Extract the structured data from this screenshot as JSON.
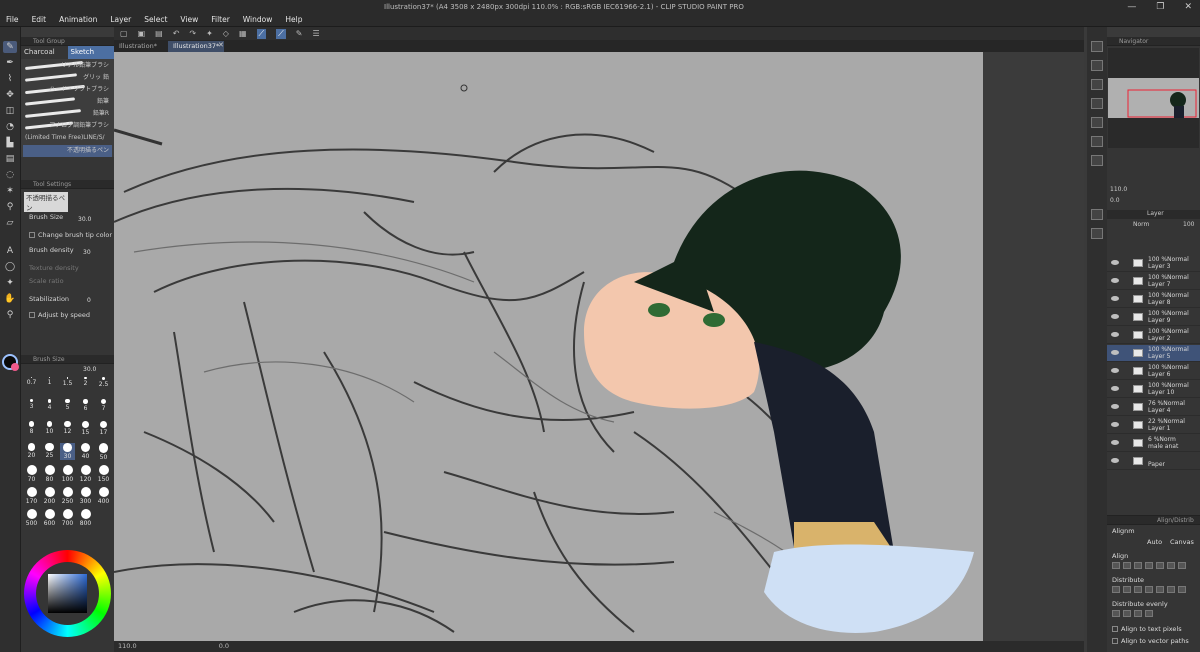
{
  "window": {
    "title": "Illustration37* (A4 3508 x 2480px 300dpi 110.0% : RGB:sRGB IEC61966-2.1) - CLIP STUDIO PAINT PRO",
    "menu": [
      "File",
      "Edit",
      "Animation",
      "Layer",
      "Select",
      "View",
      "Filter",
      "Window",
      "Help"
    ],
    "controls": [
      "—",
      "❐",
      "✕"
    ]
  },
  "doc_tabs": [
    "Illustration*",
    "Illustration37*"
  ],
  "tool_group": {
    "header": "Tool Group",
    "tabs": [
      "Charcoal",
      "Sketch"
    ],
    "active_tab": "Sketch",
    "brushes": [
      "リアル鉛筆ブラシ",
      "グリッ 鉛",
      "ハード・ソフトブラシ",
      "鉛筆",
      "鉛筆R",
      "アナログ調鉛筆ブラシ",
      "(Limited Time Free)LINE/S/",
      "不透明描るペン"
    ]
  },
  "tool_settings": {
    "header": "Tool Settings",
    "brush_name": "不透明描るペン",
    "brush_size_label": "Brush Size",
    "brush_size_value": "30.0",
    "change_tip_color": "Change brush tip color",
    "brush_density_label": "Brush density",
    "brush_density_value": "30",
    "texture_density": "Texture density",
    "scale_ratio": "Scale ratio",
    "stabilization_label": "Stabilization",
    "stabilization_value": "0",
    "adjust_by_speed": "Adjust by speed"
  },
  "brush_size_panel": {
    "header": "Brush Size",
    "current": "30.0",
    "sizes": [
      "0.7",
      "1",
      "1.5",
      "2",
      "2.5",
      "3",
      "4",
      "5",
      "6",
      "7",
      "8",
      "10",
      "12",
      "15",
      "17",
      "20",
      "25",
      "30",
      "40",
      "50",
      "70",
      "80",
      "100",
      "120",
      "150",
      "170",
      "200",
      "250",
      "300",
      "400",
      "500",
      "600",
      "700",
      "800"
    ],
    "selected": "30"
  },
  "status": {
    "zoom": "110.0",
    "rotation": "0.0"
  },
  "navigator": {
    "header": "Navigator",
    "zoom": "110.0",
    "rotation": "0.0"
  },
  "layer_panel": {
    "header": "Layer",
    "blend_mode": "Norm",
    "opacity": "100",
    "layers": [
      {
        "opacity": "100 %Normal",
        "name": "Layer 3",
        "selected": false
      },
      {
        "opacity": "100 %Normal",
        "name": "Layer 7",
        "selected": false
      },
      {
        "opacity": "100 %Normal",
        "name": "Layer 8",
        "selected": false
      },
      {
        "opacity": "100 %Normal",
        "name": "Layer 9",
        "selected": false
      },
      {
        "opacity": "100 %Normal",
        "name": "Layer 2",
        "selected": false
      },
      {
        "opacity": "100 %Normal",
        "name": "Layer 5",
        "selected": true
      },
      {
        "opacity": "100 %Normal",
        "name": "Layer 6",
        "selected": false
      },
      {
        "opacity": "100 %Normal",
        "name": "Layer 10",
        "selected": false
      },
      {
        "opacity": "76 %Normal",
        "name": "Layer 4",
        "selected": false
      },
      {
        "opacity": "22 %Normal",
        "name": "Layer 1",
        "selected": false
      },
      {
        "opacity": "6 %Norm",
        "name": "male anat",
        "selected": false
      },
      {
        "opacity": "",
        "name": "Paper",
        "selected": false
      }
    ]
  },
  "align_panel": {
    "header": "Align/Distrib",
    "align_label": "Alignm",
    "mode": "Auto",
    "target": "Canvas",
    "align": "Align",
    "distribute": "Distribute",
    "distribute_evenly": "Distribute evenly",
    "align_text_pixels": "Align to text pixels",
    "align_vector_paths": "Align to vector paths"
  },
  "colors": {
    "accent": "#4c6fa2",
    "canvas_bg": "#a9a9a9",
    "hair": "#16291c",
    "skin": "#f3c7ad",
    "coat": "#1a1f2c",
    "trim": "#d9b36b",
    "fur": "#cfe0f5"
  }
}
